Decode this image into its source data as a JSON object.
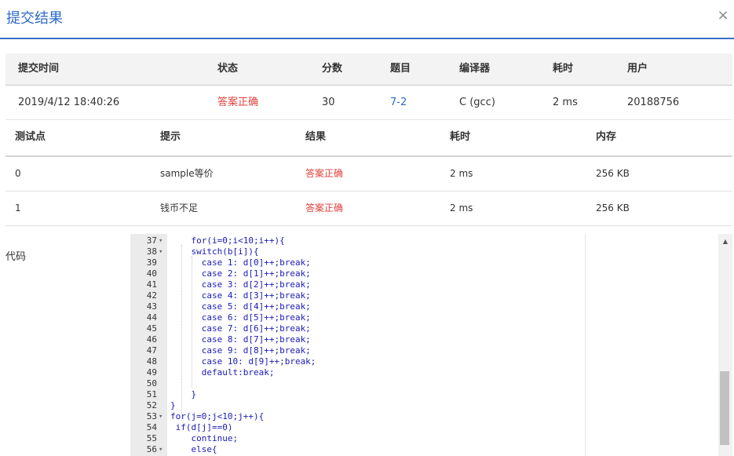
{
  "dialog": {
    "title": "提交结果",
    "close_label": "×"
  },
  "summary": {
    "headers": [
      "提交时间",
      "状态",
      "分数",
      "题目",
      "编译器",
      "耗时",
      "用户"
    ],
    "row": {
      "time": "2019/4/12 18:40:26",
      "status": "答案正确",
      "score": "30",
      "problem": "7-2",
      "compiler": "C (gcc)",
      "elapsed": "2 ms",
      "user": "20188756"
    }
  },
  "tests": {
    "headers": [
      "测试点",
      "提示",
      "结果",
      "耗时",
      "内存"
    ],
    "rows": [
      {
        "id": "0",
        "hint": "sample等价",
        "result": "答案正确",
        "time": "2 ms",
        "memory": "256 KB"
      },
      {
        "id": "1",
        "hint": "钱币不足",
        "result": "答案正确",
        "time": "2 ms",
        "memory": "256 KB"
      }
    ]
  },
  "code": {
    "label": "代码",
    "lines": [
      {
        "n": "37",
        "fold": "▾",
        "text": "    for(i=0;i<10;i++){"
      },
      {
        "n": "38",
        "fold": "▾",
        "text": "    switch(b[i]){"
      },
      {
        "n": "39",
        "fold": "",
        "text": "      case 1: d[0]++;break;"
      },
      {
        "n": "40",
        "fold": "",
        "text": "      case 2: d[1]++;break;"
      },
      {
        "n": "41",
        "fold": "",
        "text": "      case 3: d[2]++;break;"
      },
      {
        "n": "42",
        "fold": "",
        "text": "      case 4: d[3]++;break;"
      },
      {
        "n": "43",
        "fold": "",
        "text": "      case 5: d[4]++;break;"
      },
      {
        "n": "44",
        "fold": "",
        "text": "      case 6: d[5]++;break;"
      },
      {
        "n": "45",
        "fold": "",
        "text": "      case 7: d[6]++;break;"
      },
      {
        "n": "46",
        "fold": "",
        "text": "      case 8: d[7]++;break;"
      },
      {
        "n": "47",
        "fold": "",
        "text": "      case 9: d[8]++;break;"
      },
      {
        "n": "48",
        "fold": "",
        "text": "      case 10: d[9]++;break;"
      },
      {
        "n": "49",
        "fold": "",
        "text": "      default:break;"
      },
      {
        "n": "50",
        "fold": "",
        "text": ""
      },
      {
        "n": "51",
        "fold": "",
        "text": "    }"
      },
      {
        "n": "52",
        "fold": "",
        "text": "}"
      },
      {
        "n": "53",
        "fold": "▾",
        "text": "for(j=0;j<10;j++){"
      },
      {
        "n": "54",
        "fold": "",
        "text": " if(d[j]==0)"
      },
      {
        "n": "55",
        "fold": "",
        "text": "    continue;"
      },
      {
        "n": "56",
        "fold": "▾",
        "text": "    else{"
      }
    ]
  },
  "colors": {
    "accent": "#2d6ac8",
    "success": "#e0413b",
    "code_text": "#1a1ab8"
  },
  "icons": {
    "close": "close-icon",
    "fold": "fold-arrow-icon",
    "scroll_up": "scroll-up-arrow-icon"
  }
}
